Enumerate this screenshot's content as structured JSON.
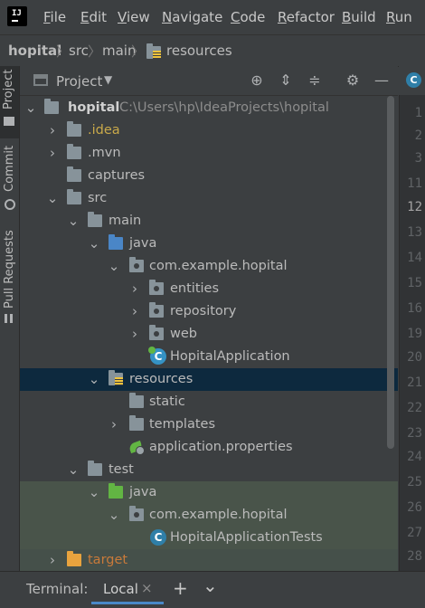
{
  "menu": {
    "items": [
      {
        "mnemonic": "F",
        "rest": "ile"
      },
      {
        "mnemonic": "E",
        "rest": "dit"
      },
      {
        "mnemonic": "V",
        "rest": "iew"
      },
      {
        "mnemonic": "N",
        "rest": "avigate"
      },
      {
        "mnemonic": "C",
        "rest": "ode"
      },
      {
        "mnemonic": "R",
        "rest": "efactor"
      },
      {
        "mnemonic": "B",
        "rest": "uild"
      },
      {
        "mnemonic": "R",
        "rest": "un"
      }
    ]
  },
  "logo": {
    "text": "IJ"
  },
  "breadcrumb": {
    "project": "hopital",
    "items": [
      "src",
      "main",
      "resources"
    ]
  },
  "toolstrip": {
    "project": "Project",
    "commit": "Commit",
    "pull_requests": "Pull Requests"
  },
  "project_panel": {
    "title": "Project",
    "icons": [
      "locate-icon",
      "expand-all-icon",
      "collapse-all-icon",
      "gear-icon",
      "minimize-icon"
    ]
  },
  "tree": {
    "root": {
      "name": "hopital",
      "path": "C:\\Users\\hp\\IdeaProjects\\hopital"
    },
    "rows": [
      {
        "label": ".idea",
        "color": "#c9a94a"
      },
      {
        "label": ".mvn"
      },
      {
        "label": "captures"
      },
      {
        "label": "src"
      },
      {
        "label": "main"
      },
      {
        "label": "java"
      },
      {
        "label": "com.example.hopital"
      },
      {
        "label": "entities"
      },
      {
        "label": "repository"
      },
      {
        "label": "web"
      },
      {
        "label": "HopitalApplication"
      },
      {
        "label": "resources"
      },
      {
        "label": "static"
      },
      {
        "label": "templates"
      },
      {
        "label": "application.properties"
      },
      {
        "label": "test"
      },
      {
        "label": "java"
      },
      {
        "label": "com.example.hopital"
      },
      {
        "label": "HopitalApplicationTests"
      },
      {
        "label": "target",
        "color": "#c97a3a"
      }
    ]
  },
  "gutter": {
    "tab_icon": "C",
    "lines": [
      "1",
      "2",
      "3",
      "11",
      "12",
      "13",
      "14",
      "15",
      "16",
      "19",
      "20",
      "21",
      "22",
      "23",
      "24",
      "25",
      "26",
      "27",
      "28"
    ],
    "current": "12"
  },
  "terminal": {
    "title": "Terminal:",
    "tab": "Local",
    "close": "×",
    "add": "+",
    "more": "⌄"
  },
  "colors": {
    "background": "#3c3f41",
    "selection": "#0d293e",
    "test_highlight": "#49544a",
    "source_folder": "#4a86c7",
    "test_folder": "#62b543",
    "excluded_folder": "#e8a33e"
  }
}
